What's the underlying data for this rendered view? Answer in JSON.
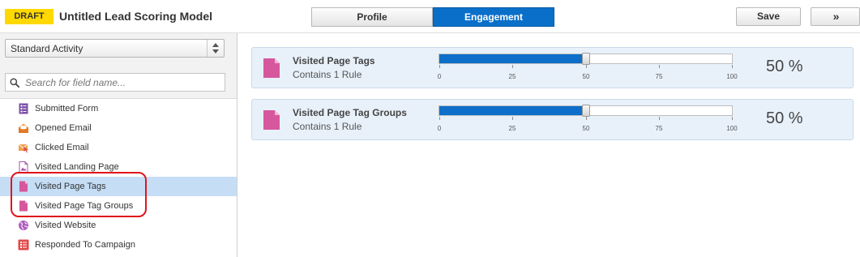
{
  "header": {
    "draft_label": "DRAFT",
    "title": "Untitled Lead Scoring Model",
    "tabs": [
      {
        "label": "Profile",
        "active": false
      },
      {
        "label": "Engagement",
        "active": true
      }
    ],
    "save_label": "Save",
    "expand_label": "»"
  },
  "sidebar": {
    "select_value": "Standard Activity",
    "search_placeholder": "Search for field name...",
    "items": [
      {
        "label": "Submitted Form",
        "icon": "form-icon",
        "selected": false
      },
      {
        "label": "Opened Email",
        "icon": "open-email-icon",
        "selected": false
      },
      {
        "label": "Clicked Email",
        "icon": "click-email-icon",
        "selected": false
      },
      {
        "label": "Visited Landing Page",
        "icon": "landing-page-icon",
        "selected": false
      },
      {
        "label": "Visited Page Tags",
        "icon": "page-tag-icon",
        "selected": true
      },
      {
        "label": "Visited Page Tag Groups",
        "icon": "page-tag-group-icon",
        "selected": false
      },
      {
        "label": "Visited Website",
        "icon": "globe-icon",
        "selected": false
      },
      {
        "label": "Responded To Campaign",
        "icon": "campaign-icon",
        "selected": false
      }
    ]
  },
  "main": {
    "cards": [
      {
        "title": "Visited Page Tags",
        "subtitle": "Contains 1 Rule",
        "value": 50,
        "percent_label": "50 %"
      },
      {
        "title": "Visited Page Tag Groups",
        "subtitle": "Contains 1 Rule",
        "value": 50,
        "percent_label": "50 %"
      }
    ],
    "scale_ticks": [
      "0",
      "25",
      "50",
      "75",
      "100"
    ]
  },
  "colors": {
    "draft": "#ffd800",
    "accent": "#0a6fc9",
    "selected_row": "#c5def6",
    "card_bg": "#e8f1fa",
    "highlight": "#e0141b",
    "page_tag_icon": "#d6579c"
  }
}
